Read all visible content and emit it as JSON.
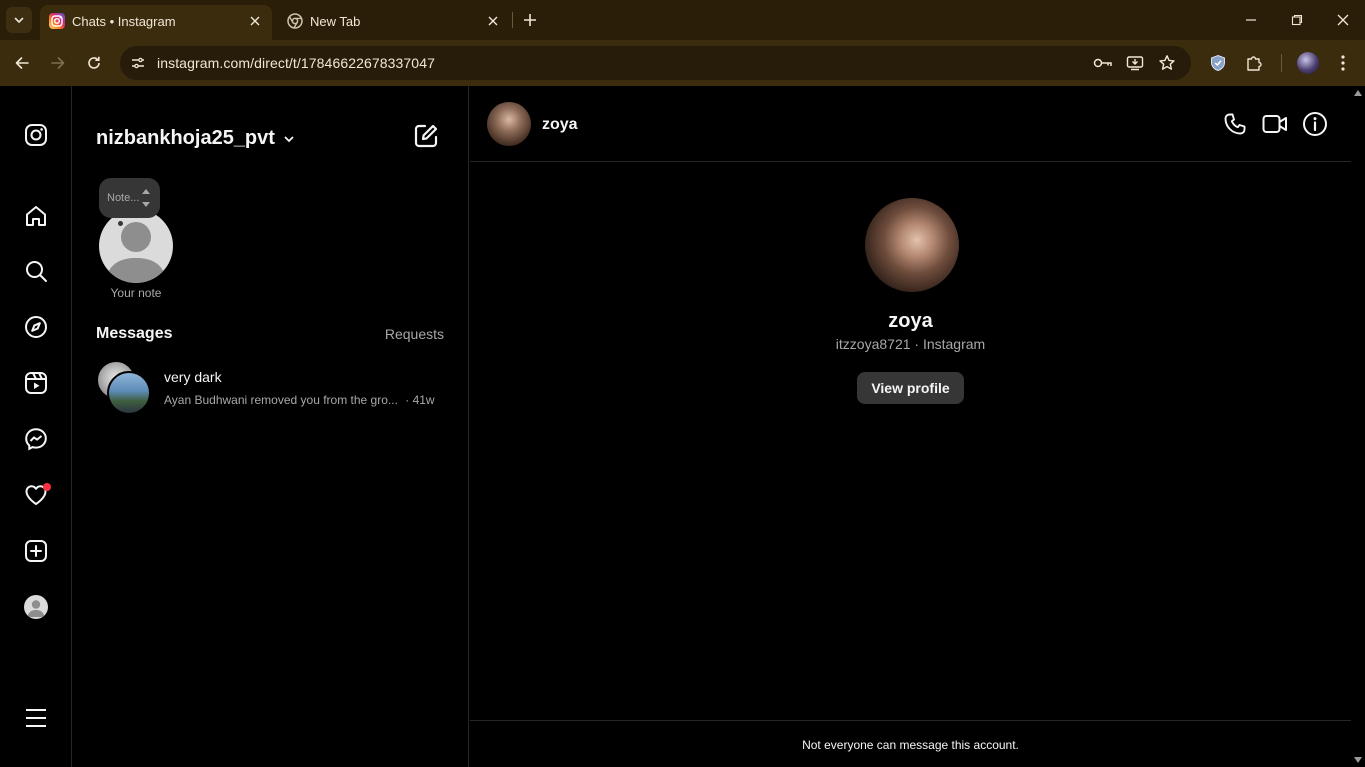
{
  "browser": {
    "tabs": [
      {
        "title": "Chats • Instagram",
        "active": true
      },
      {
        "title": "New Tab",
        "active": false
      }
    ],
    "url": "instagram.com/direct/t/17846622678337047",
    "icons": [
      "tab-search-icon",
      "instagram-favicon",
      "chrome-favicon",
      "close-icon",
      "new-tab-icon",
      "minimize-icon",
      "restore-icon",
      "close-window-icon",
      "back-icon",
      "forward-icon",
      "reload-icon",
      "site-info-icon",
      "password-key-icon",
      "install-app-icon",
      "bookmark-star-icon",
      "shield-extension-icon",
      "extensions-puzzle-icon",
      "menu-kebab-icon"
    ]
  },
  "nav": {
    "icons": [
      "instagram-logo-icon",
      "home-icon",
      "search-icon",
      "explore-compass-icon",
      "reels-icon",
      "messenger-icon",
      "notifications-heart-icon",
      "create-plus-icon",
      "profile-avatar",
      "more-menu-icon"
    ],
    "notification_dot_color": "#ff3040"
  },
  "inbox": {
    "account": "nizbankhoja25_pvt",
    "note_placeholder": "Note...",
    "note_label": "Your note",
    "messages_heading": "Messages",
    "requests_label": "Requests",
    "conversations": [
      {
        "name": "very dark",
        "preview": "Ayan Budhwani removed you from the gro...",
        "time": "· 41w"
      }
    ]
  },
  "thread": {
    "header_name": "zoya",
    "profile_name": "zoya",
    "profile_sub": "itzzoya8721 · Instagram",
    "view_profile": "View profile",
    "footer_notice": "Not everyone can message this account.",
    "header_icons": [
      "voice-call-icon",
      "video-call-icon",
      "info-icon"
    ]
  },
  "colors": {
    "chrome_frame": "#2a1e08",
    "chrome_toolbar": "#3b2c0e",
    "omnibox": "#261c09",
    "ig_bg": "#000000",
    "ig_border": "#262626",
    "button_bg": "#363636",
    "secondary_text": "#a8a8a8"
  }
}
